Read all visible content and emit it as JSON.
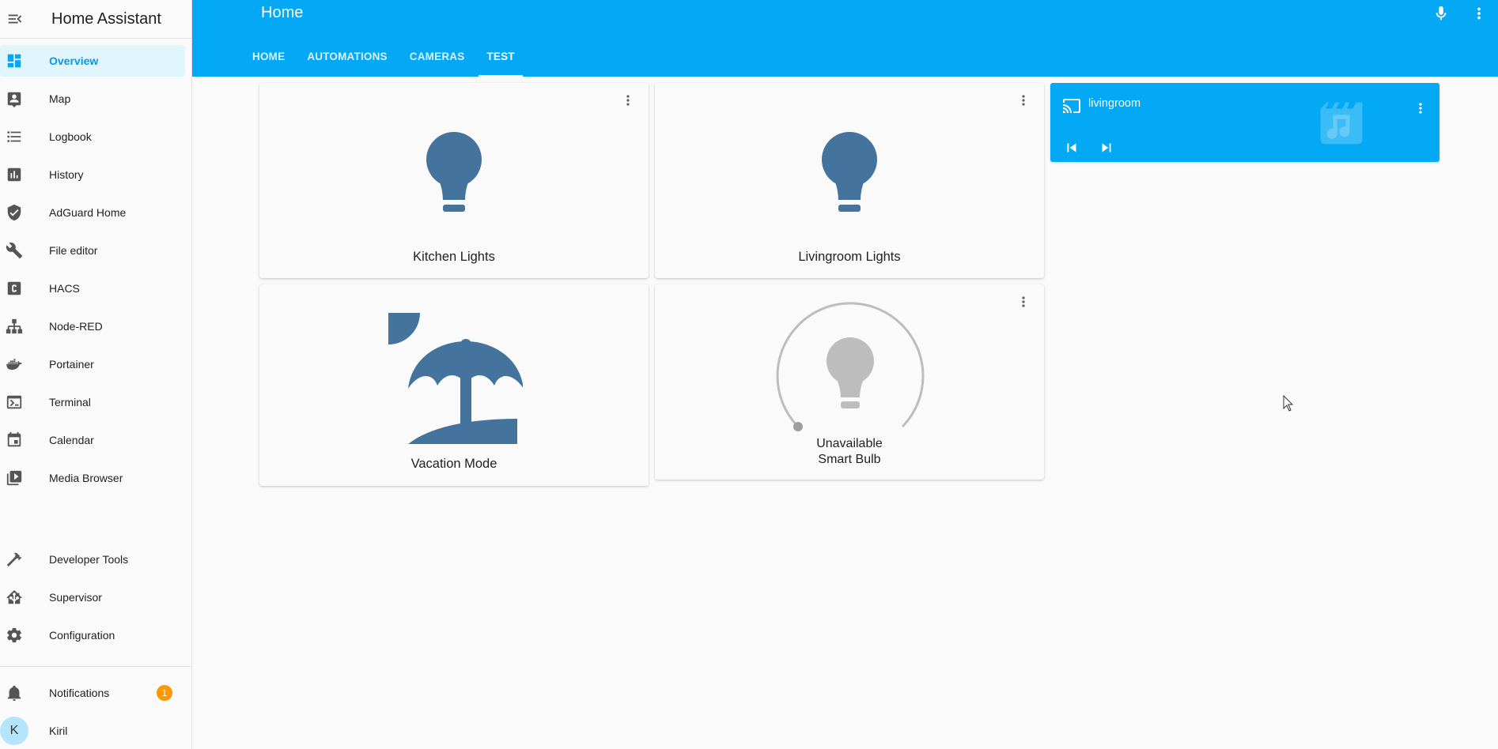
{
  "sidebar": {
    "title": "Home Assistant",
    "items": [
      {
        "label": "Overview",
        "icon": "dashboard-icon",
        "active": true
      },
      {
        "label": "Map",
        "icon": "map-account-icon"
      },
      {
        "label": "Logbook",
        "icon": "format-list-bulleted-icon"
      },
      {
        "label": "History",
        "icon": "chart-box-icon"
      },
      {
        "label": "AdGuard Home",
        "icon": "shield-check-icon"
      },
      {
        "label": "File editor",
        "icon": "wrench-icon"
      },
      {
        "label": "HACS",
        "icon": "hacs-icon"
      },
      {
        "label": "Node-RED",
        "icon": "sitemap-icon"
      },
      {
        "label": "Portainer",
        "icon": "docker-icon"
      },
      {
        "label": "Terminal",
        "icon": "console-icon"
      },
      {
        "label": "Calendar",
        "icon": "calendar-icon"
      },
      {
        "label": "Media Browser",
        "icon": "play-box-multiple-icon"
      }
    ],
    "bottom_items": [
      {
        "label": "Developer Tools",
        "icon": "hammer-icon"
      },
      {
        "label": "Supervisor",
        "icon": "home-assistant-icon"
      },
      {
        "label": "Configuration",
        "icon": "cog-icon"
      }
    ],
    "notifications": {
      "label": "Notifications",
      "count": "1"
    },
    "user": {
      "label": "Kiril",
      "initial": "K"
    }
  },
  "header": {
    "title": "Home",
    "tabs": [
      {
        "label": "HOME"
      },
      {
        "label": "AUTOMATIONS"
      },
      {
        "label": "CAMERAS"
      },
      {
        "label": "TEST",
        "active": true
      }
    ]
  },
  "cards": {
    "kitchen": {
      "name": "Kitchen Lights"
    },
    "livingroom": {
      "name": "Livingroom Lights"
    },
    "vacation": {
      "name": "Vacation Mode"
    },
    "smart_bulb": {
      "state": "Unavailable",
      "name": "Smart Bulb"
    }
  },
  "media_player": {
    "name": "livingroom"
  },
  "colors": {
    "accent": "#03a9f4",
    "light_icon": "#44739e",
    "unavailable": "#bdbdbd",
    "badge": "#ff9800"
  }
}
